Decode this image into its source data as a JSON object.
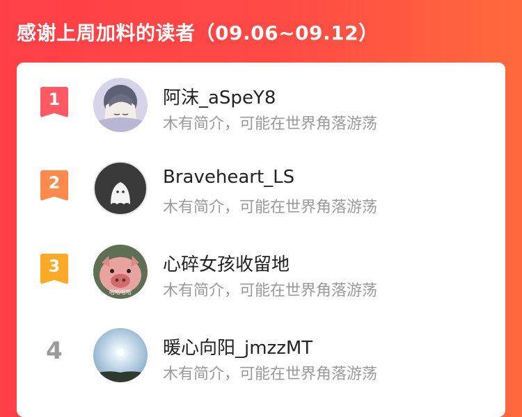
{
  "header": {
    "title": "感谢上周加料的读者（09.06~09.12）"
  },
  "readers": [
    {
      "rank": "1",
      "name": "阿沫_aSpeY8",
      "bio": "木有简介，可能在世界角落游荡",
      "avatar": "anime-boy-sleeping-avatar",
      "rank_color": "#ff5a63"
    },
    {
      "rank": "2",
      "name": "Braveheart_LS",
      "bio": "木有简介，可能在世界角落游荡",
      "avatar": "default-ghost-avatar",
      "rank_color": "#ff8a4b"
    },
    {
      "rank": "3",
      "name": "心碎女孩收留地",
      "bio": "木有简介，可能在世界角落游荡",
      "avatar": "pig-avatar",
      "avatar_caption": "哈哈哈哈",
      "rank_color": "#ffaa26"
    },
    {
      "rank": "4",
      "name": "暖心向阳_jmzzMT",
      "bio": "木有简介，可能在世界角落游荡",
      "avatar": "sun-sky-avatar"
    }
  ],
  "colors": {
    "header_gradient_start": "#ff3f47",
    "header_gradient_end": "#ff6a3c",
    "rank4_gray": "#9a9a9a"
  }
}
